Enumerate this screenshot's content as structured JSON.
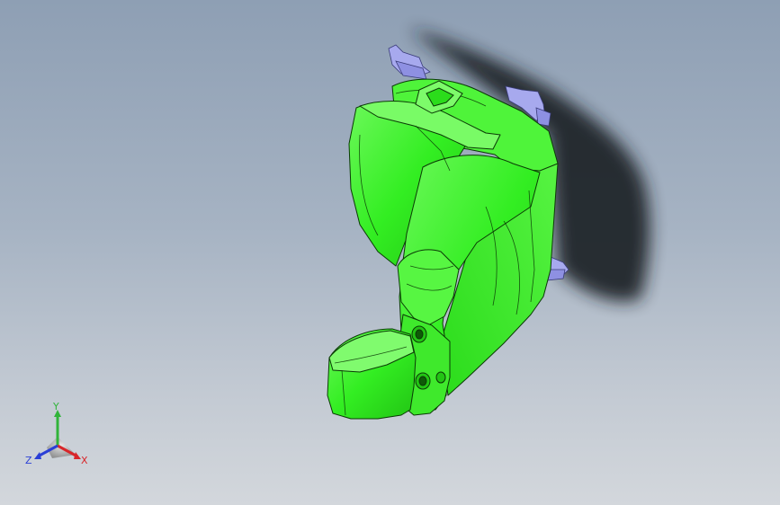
{
  "viewport": {
    "background_top": "#8e9fb4",
    "background_bottom": "#d3d7dc"
  },
  "model": {
    "body_color": "#33ee22",
    "body_highlight": "#7dfb6a",
    "body_edge": "#0b3a06",
    "bracket_color": "#a7a9ee",
    "bracket_edge": "#3a3c7a",
    "shadow_color": "#1f2226"
  },
  "triad": {
    "x_label": "X",
    "y_label": "Y",
    "z_label": "Z",
    "x_color": "#d8262a",
    "y_color": "#31b43a",
    "z_color": "#2a3fd6"
  }
}
